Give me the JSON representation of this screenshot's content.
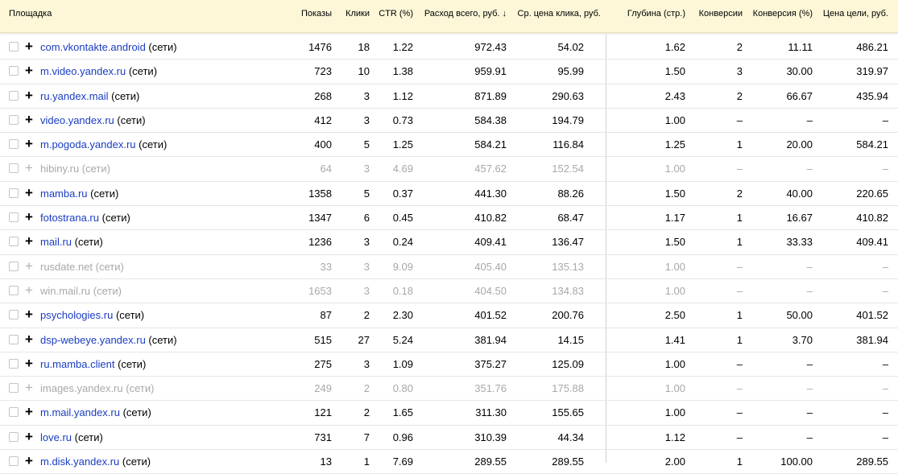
{
  "columns": {
    "site": "Площадка",
    "shows": "Показы",
    "clicks": "Клики",
    "ctr": "CTR (%)",
    "spend": "Расход всего, руб. ↓",
    "cpc": "Ср. цена клика, руб.",
    "depth": "Глубина (стр.)",
    "conv": "Конверсии",
    "conv_rate": "Конверсия (%)",
    "cpa": "Цена цели, руб."
  },
  "rows": [
    {
      "site": "com.vkontakte.android",
      "suffix": " (сети)",
      "disabled": false,
      "shows": "1476",
      "clicks": "18",
      "ctr": "1.22",
      "spend": "972.43",
      "cpc": "54.02",
      "depth": "1.62",
      "conv": "2",
      "conv_rate": "11.11",
      "cpa": "486.21"
    },
    {
      "site": "m.video.yandex.ru",
      "suffix": " (сети)",
      "disabled": false,
      "shows": "723",
      "clicks": "10",
      "ctr": "1.38",
      "spend": "959.91",
      "cpc": "95.99",
      "depth": "1.50",
      "conv": "3",
      "conv_rate": "30.00",
      "cpa": "319.97"
    },
    {
      "site": "ru.yandex.mail",
      "suffix": " (сети)",
      "disabled": false,
      "shows": "268",
      "clicks": "3",
      "ctr": "1.12",
      "spend": "871.89",
      "cpc": "290.63",
      "depth": "2.43",
      "conv": "2",
      "conv_rate": "66.67",
      "cpa": "435.94"
    },
    {
      "site": "video.yandex.ru",
      "suffix": " (сети)",
      "disabled": false,
      "shows": "412",
      "clicks": "3",
      "ctr": "0.73",
      "spend": "584.38",
      "cpc": "194.79",
      "depth": "1.00",
      "conv": "–",
      "conv_rate": "–",
      "cpa": "–"
    },
    {
      "site": "m.pogoda.yandex.ru",
      "suffix": " (сети)",
      "disabled": false,
      "shows": "400",
      "clicks": "5",
      "ctr": "1.25",
      "spend": "584.21",
      "cpc": "116.84",
      "depth": "1.25",
      "conv": "1",
      "conv_rate": "20.00",
      "cpa": "584.21"
    },
    {
      "site": "hibiny.ru",
      "suffix": " (сети)",
      "disabled": true,
      "shows": "64",
      "clicks": "3",
      "ctr": "4.69",
      "spend": "457.62",
      "cpc": "152.54",
      "depth": "1.00",
      "conv": "–",
      "conv_rate": "–",
      "cpa": "–"
    },
    {
      "site": "mamba.ru",
      "suffix": " (сети)",
      "disabled": false,
      "shows": "1358",
      "clicks": "5",
      "ctr": "0.37",
      "spend": "441.30",
      "cpc": "88.26",
      "depth": "1.50",
      "conv": "2",
      "conv_rate": "40.00",
      "cpa": "220.65"
    },
    {
      "site": "fotostrana.ru",
      "suffix": " (сети)",
      "disabled": false,
      "shows": "1347",
      "clicks": "6",
      "ctr": "0.45",
      "spend": "410.82",
      "cpc": "68.47",
      "depth": "1.17",
      "conv": "1",
      "conv_rate": "16.67",
      "cpa": "410.82"
    },
    {
      "site": "mail.ru",
      "suffix": " (сети)",
      "disabled": false,
      "shows": "1236",
      "clicks": "3",
      "ctr": "0.24",
      "spend": "409.41",
      "cpc": "136.47",
      "depth": "1.50",
      "conv": "1",
      "conv_rate": "33.33",
      "cpa": "409.41"
    },
    {
      "site": "rusdate.net",
      "suffix": " (сети)",
      "disabled": true,
      "shows": "33",
      "clicks": "3",
      "ctr": "9.09",
      "spend": "405.40",
      "cpc": "135.13",
      "depth": "1.00",
      "conv": "–",
      "conv_rate": "–",
      "cpa": "–"
    },
    {
      "site": "win.mail.ru",
      "suffix": " (сети)",
      "disabled": true,
      "shows": "1653",
      "clicks": "3",
      "ctr": "0.18",
      "spend": "404.50",
      "cpc": "134.83",
      "depth": "1.00",
      "conv": "–",
      "conv_rate": "–",
      "cpa": "–"
    },
    {
      "site": "psychologies.ru",
      "suffix": " (сети)",
      "disabled": false,
      "shows": "87",
      "clicks": "2",
      "ctr": "2.30",
      "spend": "401.52",
      "cpc": "200.76",
      "depth": "2.50",
      "conv": "1",
      "conv_rate": "50.00",
      "cpa": "401.52"
    },
    {
      "site": "dsp-webeye.yandex.ru",
      "suffix": " (сети)",
      "disabled": false,
      "shows": "515",
      "clicks": "27",
      "ctr": "5.24",
      "spend": "381.94",
      "cpc": "14.15",
      "depth": "1.41",
      "conv": "1",
      "conv_rate": "3.70",
      "cpa": "381.94"
    },
    {
      "site": "ru.mamba.client",
      "suffix": " (сети)",
      "disabled": false,
      "shows": "275",
      "clicks": "3",
      "ctr": "1.09",
      "spend": "375.27",
      "cpc": "125.09",
      "depth": "1.00",
      "conv": "–",
      "conv_rate": "–",
      "cpa": "–"
    },
    {
      "site": "images.yandex.ru",
      "suffix": " (сети)",
      "disabled": true,
      "shows": "249",
      "clicks": "2",
      "ctr": "0.80",
      "spend": "351.76",
      "cpc": "175.88",
      "depth": "1.00",
      "conv": "–",
      "conv_rate": "–",
      "cpa": "–"
    },
    {
      "site": "m.mail.yandex.ru",
      "suffix": " (сети)",
      "disabled": false,
      "shows": "121",
      "clicks": "2",
      "ctr": "1.65",
      "spend": "311.30",
      "cpc": "155.65",
      "depth": "1.00",
      "conv": "–",
      "conv_rate": "–",
      "cpa": "–"
    },
    {
      "site": "love.ru",
      "suffix": " (сети)",
      "disabled": false,
      "shows": "731",
      "clicks": "7",
      "ctr": "0.96",
      "spend": "310.39",
      "cpc": "44.34",
      "depth": "1.12",
      "conv": "–",
      "conv_rate": "–",
      "cpa": "–"
    },
    {
      "site": "m.disk.yandex.ru",
      "suffix": " (сети)",
      "disabled": false,
      "shows": "13",
      "clicks": "1",
      "ctr": "7.69",
      "spend": "289.55",
      "cpc": "289.55",
      "depth": "2.00",
      "conv": "1",
      "conv_rate": "100.00",
      "cpa": "289.55"
    }
  ],
  "colors": {
    "header_bg": "#fdf7d8",
    "link": "#1a3dc1",
    "disabled": "#a8a8a8"
  }
}
